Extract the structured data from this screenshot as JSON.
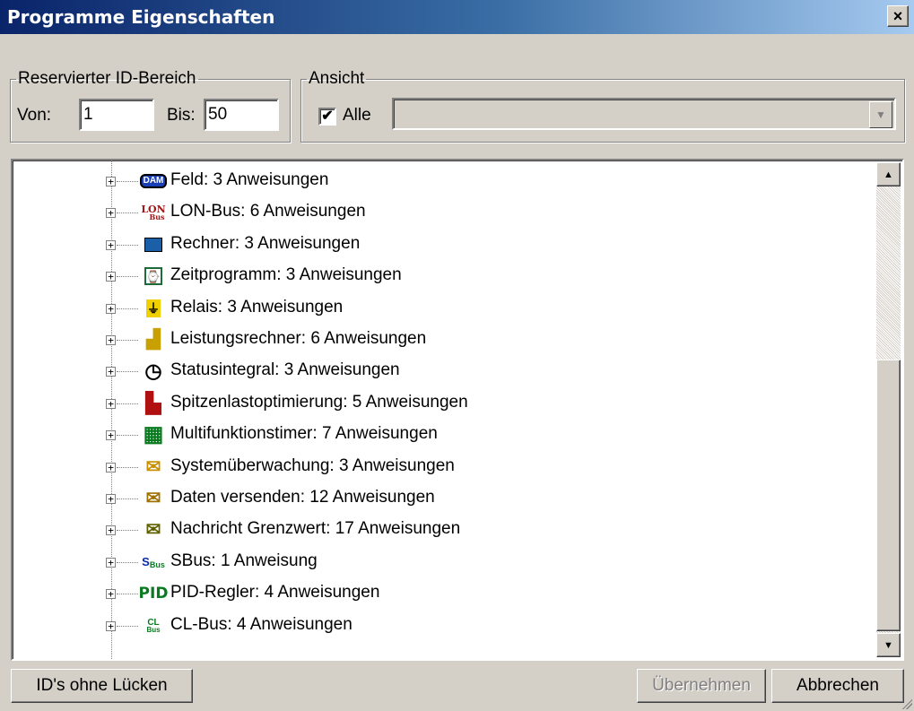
{
  "window": {
    "title": "Programme Eigenschaften",
    "close_label": "×"
  },
  "reserved": {
    "legend": "Reservierter ID-Bereich",
    "from_label": "Von:",
    "from_value": "1",
    "to_label": "Bis:",
    "to_value": "50"
  },
  "view": {
    "legend": "Ansicht",
    "all_label": "Alle",
    "all_checked": true,
    "selected": ""
  },
  "tree": {
    "items": [
      {
        "icon": "dam-icon",
        "label": "Feld: 3 Anweisungen"
      },
      {
        "icon": "lon-bus-icon",
        "label": "LON-Bus: 6 Anweisungen"
      },
      {
        "icon": "calculator-icon",
        "label": "Rechner: 3 Anweisungen"
      },
      {
        "icon": "timer-program-icon",
        "label": "Zeitprogramm: 3 Anweisungen"
      },
      {
        "icon": "relay-icon",
        "label": "Relais: 3 Anweisungen"
      },
      {
        "icon": "power-calculator-icon",
        "label": "Leistungsrechner: 6 Anweisungen"
      },
      {
        "icon": "status-integral-icon",
        "label": "Statusintegral: 3 Anweisungen"
      },
      {
        "icon": "peak-load-icon",
        "label": "Spitzenlastoptimierung: 5 Anweisungen"
      },
      {
        "icon": "multifunction-timer-icon",
        "label": "Multifunktionstimer: 7 Anweisungen"
      },
      {
        "icon": "system-monitor-icon",
        "label": "Systemüberwachung: 3 Anweisungen"
      },
      {
        "icon": "send-data-icon",
        "label": "Daten versenden: 12 Anweisungen"
      },
      {
        "icon": "limit-message-icon",
        "label": "Nachricht Grenzwert: 17 Anweisungen"
      },
      {
        "icon": "sbus-icon",
        "label": "SBus: 1 Anweisung"
      },
      {
        "icon": "pid-icon",
        "label": "PID-Regler: 4 Anweisungen"
      },
      {
        "icon": "cl-bus-icon",
        "label": "CL-Bus: 4 Anweisungen"
      }
    ]
  },
  "buttons": {
    "no_gaps": "ID's ohne Lücken",
    "apply": "Übernehmen",
    "cancel": "Abbrechen"
  },
  "colors": {
    "title_start": "#0a246a",
    "title_end": "#a6caf0",
    "face": "#d4d0c8"
  }
}
